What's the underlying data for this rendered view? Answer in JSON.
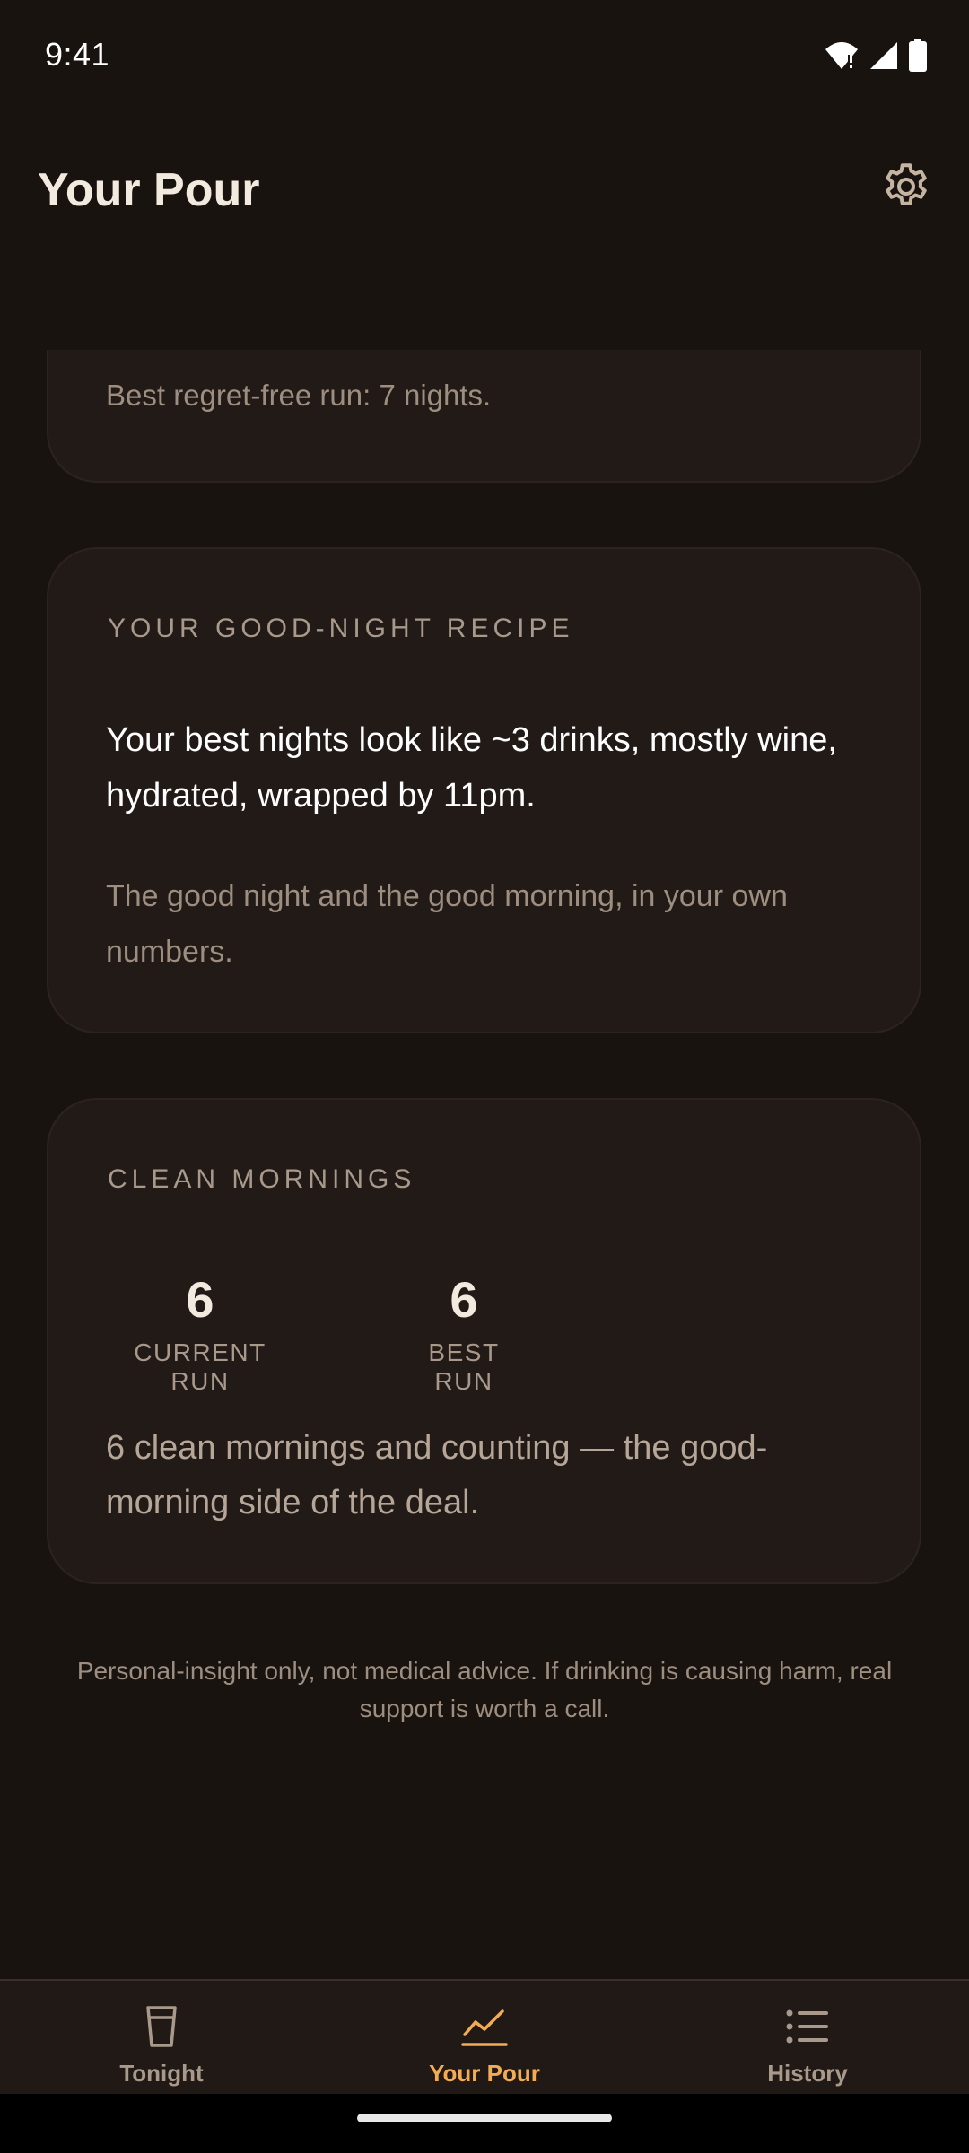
{
  "status_bar": {
    "time": "9:41",
    "icons": [
      "wifi-icon",
      "signal-icon",
      "battery-icon"
    ]
  },
  "app_bar": {
    "title": "Your Pour",
    "settings_icon": "gear-icon"
  },
  "cards": {
    "top_partial": {
      "text": "Best regret-free run: 7 nights."
    },
    "recipe": {
      "label": "YOUR GOOD-NIGHT RECIPE",
      "headline": "Your best nights look like ~3 drinks, mostly wine, hydrated, wrapped by 11pm.",
      "sub": "The good night and the good morning, in your own numbers."
    },
    "mornings": {
      "label": "CLEAN MORNINGS",
      "current_value": "6",
      "current_label": "CURRENT RUN",
      "best_value": "6",
      "best_label": "BEST RUN",
      "text": "6 clean mornings and counting — the good-morning side of the deal."
    }
  },
  "disclaimer": "Personal-insight only, not medical advice. If drinking is causing harm, real support is worth a call.",
  "bottom_nav": {
    "items": [
      {
        "label": "Tonight",
        "icon": "glass-icon"
      },
      {
        "label": "Your Pour",
        "icon": "trend-chart-icon",
        "active": true
      },
      {
        "label": "History",
        "icon": "list-icon"
      }
    ]
  },
  "colors": {
    "background": "#19130f",
    "card": "#221a17",
    "accent": "#f2ac54",
    "muted_text": "#9d8e80"
  }
}
